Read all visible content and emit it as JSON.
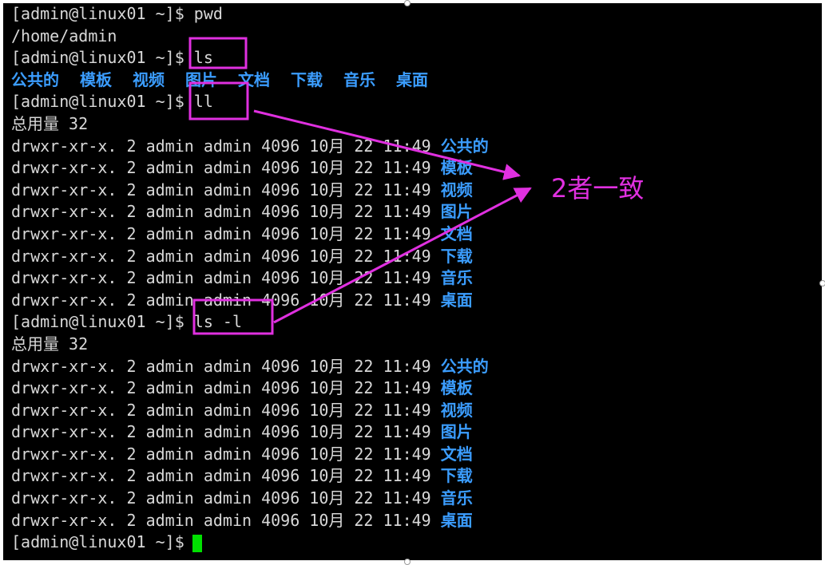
{
  "prompt": "[admin@linux01 ~]$",
  "cmd_pwd": "pwd",
  "out_pwd": "/home/admin",
  "cmd_ls": "ls",
  "dirs": [
    "公共的",
    "模板",
    "视频",
    "图片",
    "文档",
    "下载",
    "音乐",
    "桌面"
  ],
  "cmd_ll": "ll",
  "total": "总用量 32",
  "perm_prefix": "drwxr-xr-x. 2 admin admin 4096 10月 22 11:49",
  "cmd_lsl": "ls -l",
  "annotation": "2者一致",
  "colors": {
    "annotation": "#e030e0",
    "dir": "#3b9dff",
    "cursor": "#00e000"
  }
}
